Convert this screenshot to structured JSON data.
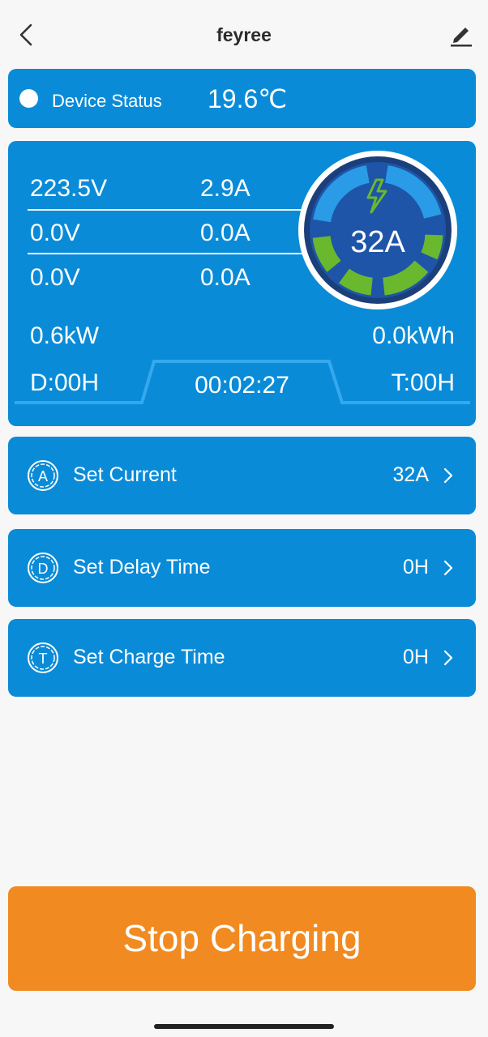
{
  "header": {
    "title": "feyree",
    "back_icon": "chevron-left-icon",
    "edit_icon": "pencil-icon"
  },
  "status": {
    "label": "Device Status",
    "temperature": "19.6℃"
  },
  "metrics": {
    "rows": [
      {
        "voltage": "223.5V",
        "current": "2.9A"
      },
      {
        "voltage": "0.0V",
        "current": "0.0A"
      },
      {
        "voltage": "0.0V",
        "current": "0.0A"
      }
    ],
    "power": "0.6kW",
    "energy": "0.0kWh",
    "delay": "D:00H",
    "timer": "00:02:27",
    "charge_time": "T:00H"
  },
  "gauge": {
    "value": "32A",
    "icon": "lightning-bolt-icon",
    "colors": {
      "active": "#6ab82d",
      "inactive": "#2a9be6",
      "face": "#1e55a8"
    }
  },
  "settings": [
    {
      "letter": "A",
      "label": "Set Current",
      "value": "32A"
    },
    {
      "letter": "D",
      "label": "Set Delay Time",
      "value": "0H"
    },
    {
      "letter": "T",
      "label": "Set Charge Time",
      "value": "0H"
    }
  ],
  "stop_button": {
    "label": "Stop Charging"
  },
  "colors": {
    "card": "#0a8bd8",
    "stop": "#f18a20",
    "background": "#f7f7f7"
  }
}
